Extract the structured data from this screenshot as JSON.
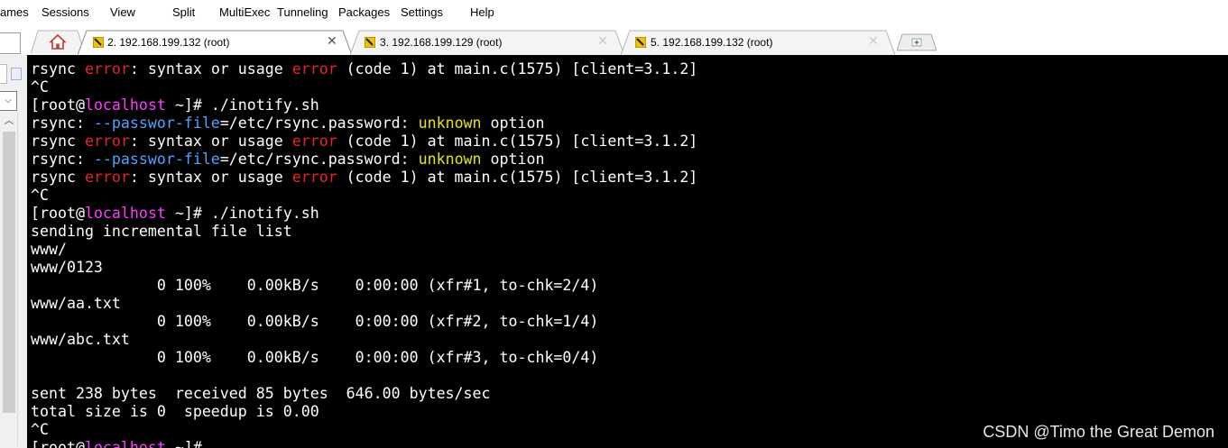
{
  "menu": [
    "ames",
    "Sessions",
    "View",
    "Split",
    "MultiExec",
    "Tunneling",
    "Packages",
    "Settings",
    "Help"
  ],
  "tabs": [
    {
      "label": "2. 192.168.199.132 (root)",
      "active": true,
      "icon": "terminal-session-icon"
    },
    {
      "label": "3. 192.168.199.129 (root)",
      "active": false,
      "icon": "terminal-session-icon"
    },
    {
      "label": "5. 192.168.199.132 (root)",
      "active": false,
      "icon": "terminal-session-icon"
    }
  ],
  "home_tab_icon": "home-icon",
  "new_tab_icon": "new-tab-icon",
  "colors": {
    "error": "#e8242a",
    "option": "#4fa3ff",
    "hostname": "#ff3cff",
    "unknown": "#e6e600",
    "text": "#ffffff",
    "background": "#000000"
  },
  "terminal_lines": [
    [
      [
        "rsync ",
        ""
      ],
      [
        "error",
        "red"
      ],
      [
        ": syntax or usage ",
        ""
      ],
      [
        "error",
        "red"
      ],
      [
        " (code 1) at main.c(1575) [client=3.1.2]",
        ""
      ]
    ],
    [
      [
        "^C",
        ""
      ]
    ],
    [
      [
        "[root@",
        ""
      ],
      [
        "localhost",
        "mag"
      ],
      [
        " ~]# ./inotify.sh",
        ""
      ]
    ],
    [
      [
        "rsync: ",
        ""
      ],
      [
        "--passwor-file",
        "blue"
      ],
      [
        "=/etc/rsync.password: ",
        ""
      ],
      [
        "unknown",
        "yel"
      ],
      [
        " option",
        ""
      ]
    ],
    [
      [
        "rsync ",
        ""
      ],
      [
        "error",
        "red"
      ],
      [
        ": syntax or usage ",
        ""
      ],
      [
        "error",
        "red"
      ],
      [
        " (code 1) at main.c(1575) [client=3.1.2]",
        ""
      ]
    ],
    [
      [
        "rsync: ",
        ""
      ],
      [
        "--passwor-file",
        "blue"
      ],
      [
        "=/etc/rsync.password: ",
        ""
      ],
      [
        "unknown",
        "yel"
      ],
      [
        " option",
        ""
      ]
    ],
    [
      [
        "rsync ",
        ""
      ],
      [
        "error",
        "red"
      ],
      [
        ": syntax or usage ",
        ""
      ],
      [
        "error",
        "red"
      ],
      [
        " (code 1) at main.c(1575) [client=3.1.2]",
        ""
      ]
    ],
    [
      [
        "^C",
        ""
      ]
    ],
    [
      [
        "[root@",
        ""
      ],
      [
        "localhost",
        "mag"
      ],
      [
        " ~]# ./inotify.sh",
        ""
      ]
    ],
    [
      [
        "sending incremental file list",
        ""
      ]
    ],
    [
      [
        "www/",
        ""
      ]
    ],
    [
      [
        "www/0123",
        ""
      ]
    ],
    [
      [
        "              0 100%    0.00kB/s    0:00:00 (xfr#1, to-chk=2/4)",
        ""
      ]
    ],
    [
      [
        "www/aa.txt",
        ""
      ]
    ],
    [
      [
        "              0 100%    0.00kB/s    0:00:00 (xfr#2, to-chk=1/4)",
        ""
      ]
    ],
    [
      [
        "www/abc.txt",
        ""
      ]
    ],
    [
      [
        "              0 100%    0.00kB/s    0:00:00 (xfr#3, to-chk=0/4)",
        ""
      ]
    ],
    [
      [
        "",
        ""
      ]
    ],
    [
      [
        "sent 238 bytes  received 85 bytes  646.00 bytes/sec",
        ""
      ]
    ],
    [
      [
        "total size is 0  speedup is 0.00",
        ""
      ]
    ],
    [
      [
        "^C",
        ""
      ]
    ],
    [
      [
        "[root@",
        ""
      ],
      [
        "localhost",
        "mag"
      ],
      [
        " ~]#",
        ""
      ]
    ]
  ],
  "watermark": "CSDN @Timo the Great Demon"
}
